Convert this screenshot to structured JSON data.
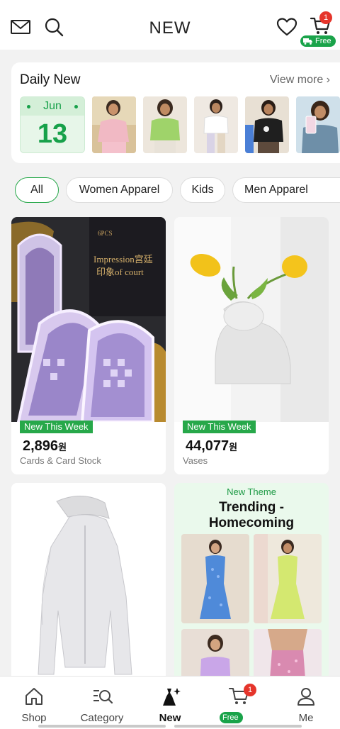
{
  "header": {
    "title": "NEW",
    "cart_count": "1",
    "free_label": "Free"
  },
  "daily_new": {
    "title": "Daily New",
    "view_more": "View more",
    "month": "Jun",
    "day": "13"
  },
  "filters": [
    "All",
    "Women Apparel",
    "Kids",
    "Men Apparel"
  ],
  "products": [
    {
      "tag": "New This Week",
      "price": "2,896",
      "currency": "원",
      "category": "Cards & Card Stock",
      "image_text_1": "Impression宫廷",
      "image_text_2": "印象of court",
      "image_text_3": "6PCS"
    },
    {
      "tag": "New This Week",
      "price": "44,077",
      "currency": "원",
      "category": "Vases"
    }
  ],
  "theme": {
    "kicker": "New Theme",
    "title": "Trending - Homecoming"
  },
  "nav": [
    {
      "label": "Shop"
    },
    {
      "label": "Category"
    },
    {
      "label": "New"
    },
    {
      "label": "Free",
      "badge": "1"
    },
    {
      "label": "Me"
    }
  ],
  "colors": {
    "accent": "#27a84a",
    "badge": "#e5352b"
  }
}
